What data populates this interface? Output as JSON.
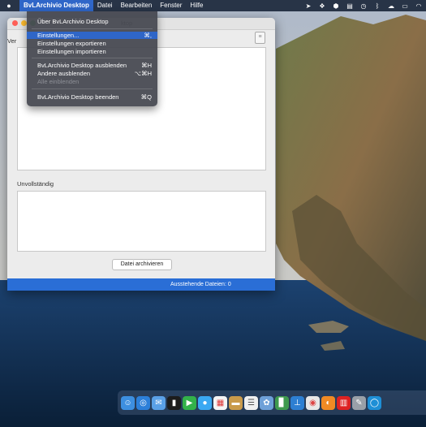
{
  "menubar": {
    "apple_icon": "apple-logo-icon",
    "app_name": "BvLArchivio Desktop",
    "menus": [
      "Datei",
      "Bearbeiten",
      "Fenster",
      "Hilfe"
    ],
    "status_icons": [
      "location-icon",
      "dropbox-icon",
      "shield-icon",
      "clipboard-icon",
      "clock-icon",
      "bluetooth-icon",
      "cloud-icon",
      "keyboard-icon",
      "wifi-icon"
    ]
  },
  "window": {
    "title": "ktop",
    "section_top_label": "Ver",
    "section_bottom_label": "Unvollständig",
    "archive_button": "Datei archivieren",
    "status_text": "Ausstehende Dateien:  0"
  },
  "app_menu": {
    "items": [
      {
        "label": "Über BvLArchivio Desktop",
        "shortcut": ""
      },
      {
        "label": "Einstellungen...",
        "shortcut": "⌘,"
      },
      {
        "label": "Einstellungen exportieren",
        "shortcut": ""
      },
      {
        "label": "Einstellungen importieren",
        "shortcut": ""
      },
      {
        "label": "BvLArchivio Desktop ausblenden",
        "shortcut": "⌘H"
      },
      {
        "label": "Andere ausblenden",
        "shortcut": "⌥⌘H"
      },
      {
        "label": "Alle einblenden",
        "shortcut": ""
      },
      {
        "label": "BvLArchivio Desktop beenden",
        "shortcut": "⌘Q"
      }
    ]
  },
  "dock": {
    "apps": [
      "finder-icon",
      "safari-icon",
      "mail-icon",
      "terminal-icon",
      "facetime-icon",
      "messages-icon",
      "calendar-icon",
      "notes-icon",
      "reminders-icon",
      "photos-icon",
      "numbers-icon",
      "keynote-icon",
      "chrome-icon",
      "firefox-icon",
      "archive-icon",
      "script-icon",
      "browser-icon"
    ]
  },
  "colors": {
    "accent": "#2f66c8",
    "statusbar": "#2a6ed6"
  }
}
